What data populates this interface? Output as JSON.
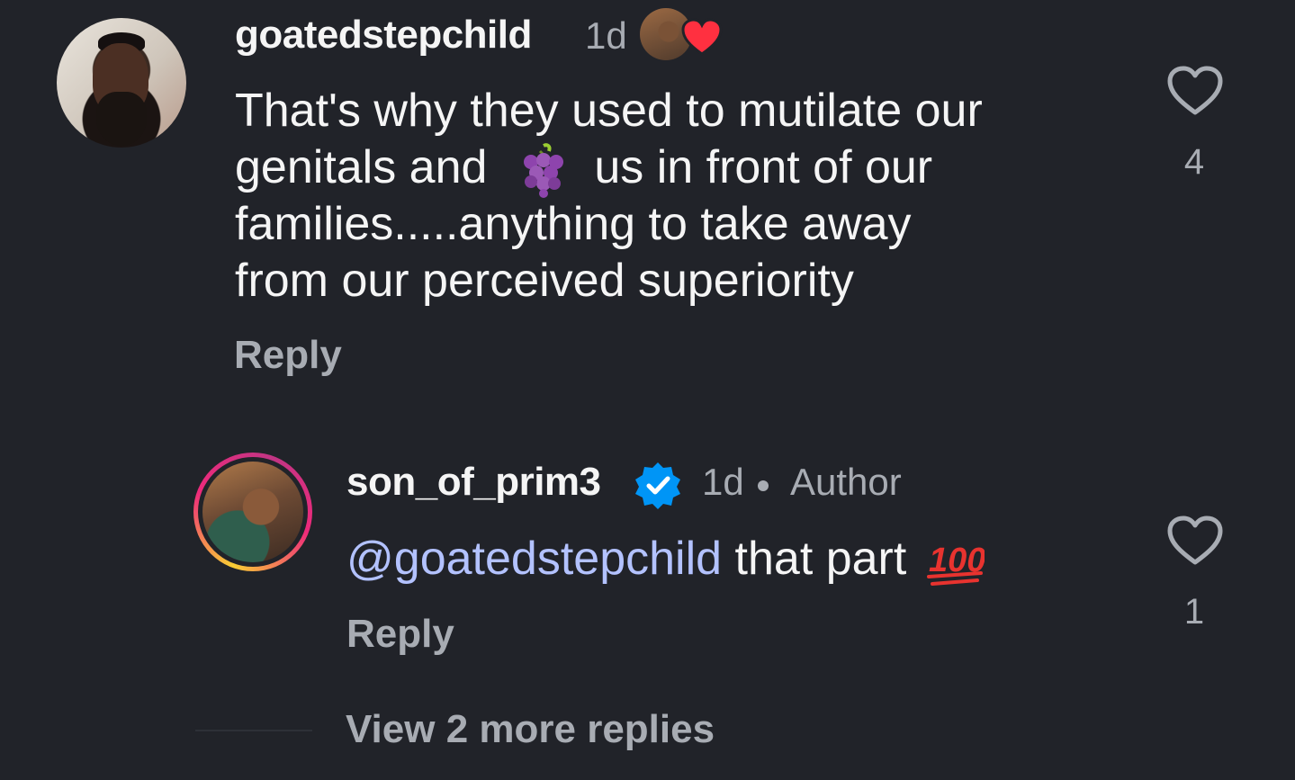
{
  "comments": [
    {
      "username": "goatedstepchild",
      "time": "1d",
      "text_lines": [
        "That's why they used to mutilate our",
        "genitals and",
        "us in front of our",
        "families.....anything to take away",
        "from our perceived superiority"
      ],
      "emoji": "grapes-emoji",
      "reply_label": "Reply",
      "like_count": "4",
      "liked_by_author": true
    },
    {
      "username": "son_of_prim3",
      "verified": true,
      "time": "1d",
      "author_label": "Author",
      "mention": "@goatedstepchild",
      "text": "that part",
      "emoji": "hundred-points-emoji",
      "reply_label": "Reply",
      "like_count": "1"
    }
  ],
  "view_more_label": "View 2 more replies",
  "colors": {
    "background": "#212329",
    "secondary_text": "#a8acb3",
    "mention": "#b3c2ff",
    "verified": "#0095f6",
    "heart": "#ff3040"
  }
}
